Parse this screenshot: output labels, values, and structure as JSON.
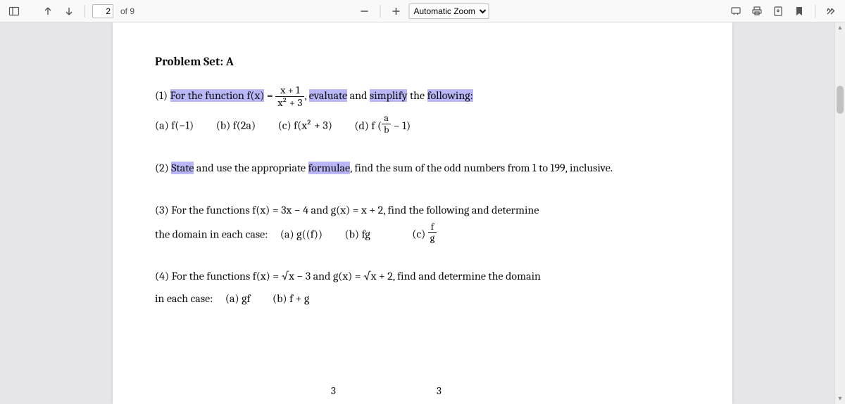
{
  "toolbar": {
    "page_input": "2",
    "page_total": "of 9",
    "zoom_options": [
      "Automatic Zoom"
    ],
    "zoom_selected": "Automatic Zoom"
  },
  "document": {
    "title": "Problem Set: A",
    "p1": {
      "num": "(1) ",
      "t1": "For the function f(x)",
      "eq": " = ",
      "frac_num": "x + 1",
      "frac_den": "x² + 3",
      "comma": ", ",
      "t2": "evaluate",
      "sp1": "  and ",
      "t3": "simplify",
      "sp2": " the ",
      "t4": "following:",
      "opt_a": "(a) f(−1)",
      "opt_b": "(b) f(2a)",
      "opt_c": "(c) f(x² + 3)",
      "opt_d_pre": "(d) f (",
      "opt_d_num": "a",
      "opt_d_den": "b",
      "opt_d_post": " − 1)"
    },
    "p2": {
      "num": "(2)  ",
      "t1": "State",
      "sp1": "  and use the appropriate ",
      "t2": "formulae",
      "rest": ", find the sum of the odd numbers from 1 to 199, inclusive."
    },
    "p3": {
      "line1": "(3) For the functions  f(x) = 3x − 4 and g(x) = x + 2, find the following and determine",
      "line2a": "the domain in each case:",
      "opt_a": "(a) g((f))",
      "opt_b": "(b) fg",
      "opt_c_pre": "(c) ",
      "opt_c_num": "f",
      "opt_c_den": "g"
    },
    "p4": {
      "line1": "(4) For the functions  f(x) = √x − 3  and g(x) = √x + 2,   find  and determine  the domain",
      "line2a": "in each case:",
      "opt_a": "(a) gf",
      "opt_b": "(b) f + g"
    },
    "bottom_nums": {
      "left": "3",
      "right": "3"
    }
  }
}
